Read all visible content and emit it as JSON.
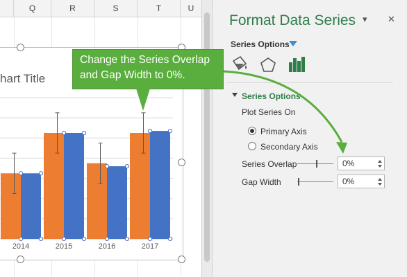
{
  "sheet": {
    "columns": [
      "Q",
      "R",
      "S",
      "T",
      "U"
    ]
  },
  "chart": {
    "title": "hart Title",
    "categories": [
      "2014",
      "2015",
      "2016",
      "2017"
    ]
  },
  "chart_data": {
    "type": "bar",
    "title": "Chart Title",
    "categories": [
      "2014",
      "2015",
      "2016",
      "2017"
    ],
    "series": [
      {
        "values": [
          6.5,
          10.5,
          7.5,
          10.5
        ]
      },
      {
        "values": [
          6.5,
          10.5,
          7.2,
          10.7
        ]
      }
    ],
    "colors": [
      "#ed7d31",
      "#4472c4"
    ],
    "ylim": [
      0,
      14
    ],
    "grid": true,
    "error_bars": true
  },
  "callout": {
    "text": "Change the Series Overlap and Gap Width to 0%."
  },
  "pane": {
    "title": "Format Data Series",
    "dropdown_glyph": "▾",
    "close_glyph": "✕",
    "series_options_menu": "Series Options",
    "tab_icons": [
      "fill-line-icon",
      "effects-pentagon-icon",
      "series-options-bar-icon"
    ],
    "section_header": "Series Options",
    "plot_series_on": "Plot Series On",
    "primary_axis": "Primary Axis",
    "secondary_axis": "Secondary Axis",
    "selected_axis": "Primary Axis",
    "series_overlap_label": "Series Overlap",
    "series_overlap_value": "0%",
    "gap_width_label": "Gap Width",
    "gap_width_value": "0%"
  },
  "colors": {
    "accent_green": "#2e7d4a",
    "callout_green": "#5aae3d",
    "orange": "#ed7d31",
    "blue": "#4472c4"
  }
}
